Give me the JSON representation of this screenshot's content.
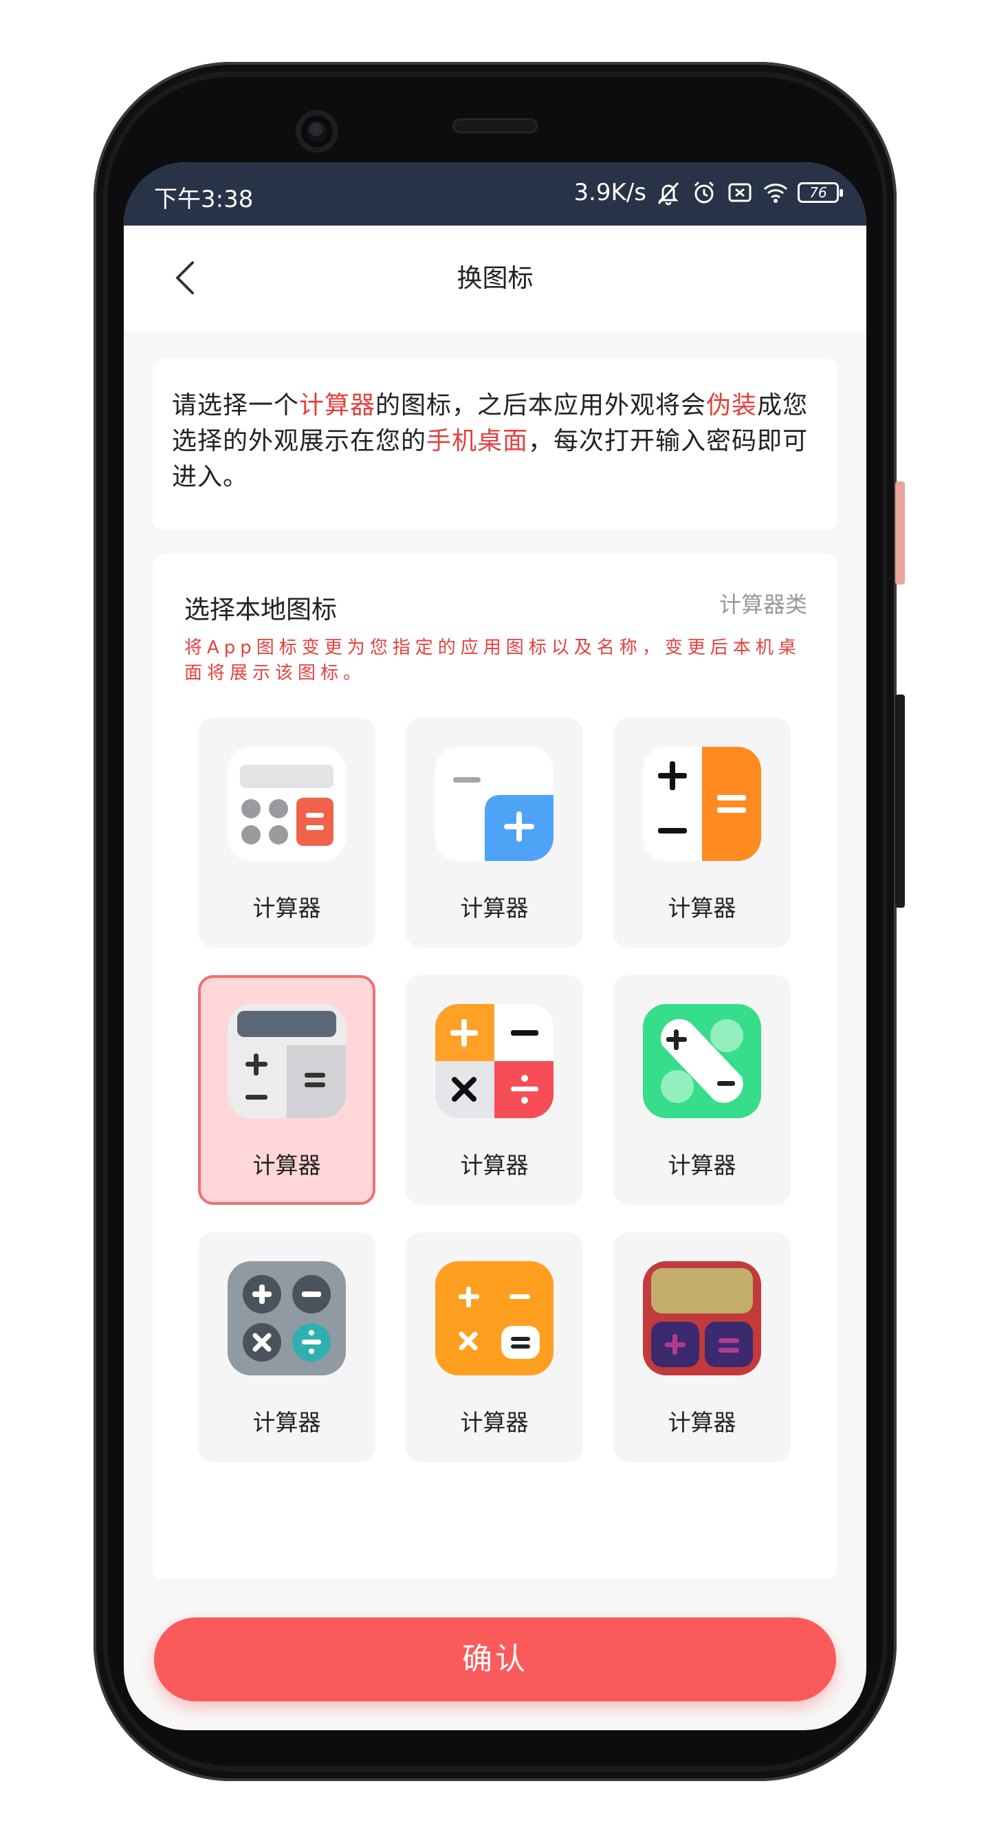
{
  "status_bar": {
    "time": "下午3:38",
    "net_speed": "3.9K/s",
    "battery": "76"
  },
  "header": {
    "title": "换图标"
  },
  "intro": {
    "part1": "请选择一个",
    "highlight1": "计算器",
    "part2": "的图标，之后本应用外观将会",
    "highlight2": "伪装",
    "part3": "成您选择的外观展示在您的",
    "highlight3": "手机桌面",
    "part4": "，每次打开输入密码即可进入。"
  },
  "section": {
    "title": "选择本地图标",
    "category": "计算器类",
    "note": "将App图标变更为您指定的应用图标以及名称，变更后本机桌面将展示该图标。"
  },
  "icons": [
    {
      "label": "计算器",
      "selected": false
    },
    {
      "label": "计算器",
      "selected": false
    },
    {
      "label": "计算器",
      "selected": false
    },
    {
      "label": "计算器",
      "selected": true
    },
    {
      "label": "计算器",
      "selected": false
    },
    {
      "label": "计算器",
      "selected": false
    },
    {
      "label": "计算器",
      "selected": false
    },
    {
      "label": "计算器",
      "selected": false
    },
    {
      "label": "计算器",
      "selected": false
    }
  ],
  "confirm_label": "确认",
  "colors": {
    "accent": "#fb5a5a",
    "highlight_text": "#e6403d",
    "status_bar": "#283347"
  }
}
